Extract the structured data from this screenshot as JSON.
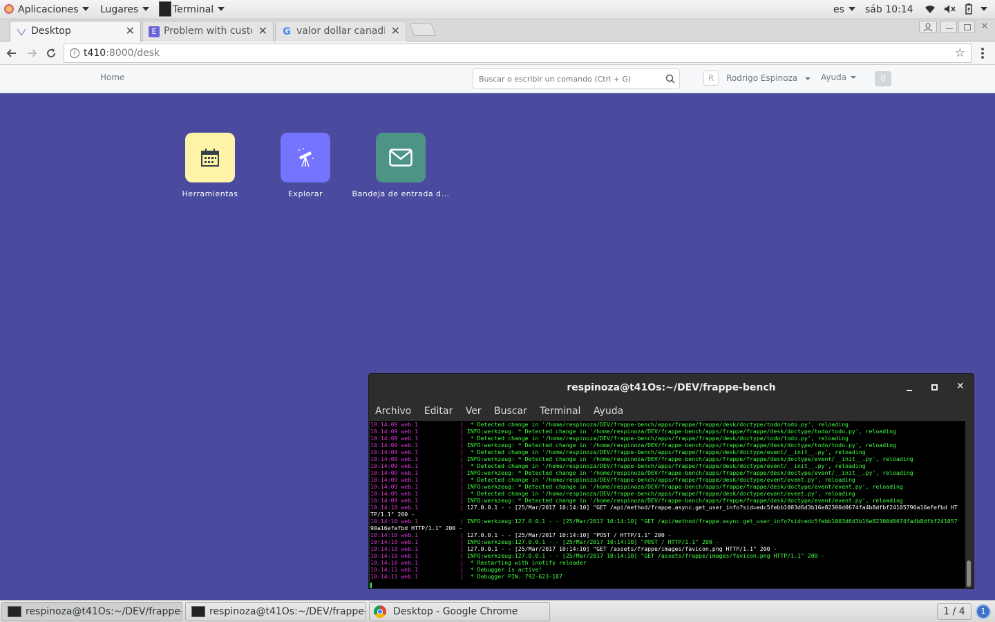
{
  "topbar": {
    "applications": "Aplicaciones",
    "places": "Lugares",
    "active_app": "Terminal",
    "language": "es",
    "clock": "sáb 10:14"
  },
  "browser": {
    "tabs": [
      {
        "label": "Desktop",
        "icon": "frappe-desk-icon"
      },
      {
        "label": "Problem with custo",
        "icon": "letter-e-icon"
      },
      {
        "label": "valor dollar canadie",
        "icon": "google-icon"
      }
    ],
    "url_host": "t410",
    "url_rest": ":8000/desk"
  },
  "navbar": {
    "home": "Home",
    "search_placeholder": "Buscar o escribir un comando (Ctrl + G)",
    "avatar_letter": "R",
    "user": "Rodrigo Espinoza",
    "help": "Ayuda",
    "notifications": "0"
  },
  "desk": {
    "icons": [
      {
        "label": "Herramientas",
        "icon": "calendar-icon",
        "color": "#fef3a6"
      },
      {
        "label": "Explorar",
        "icon": "telescope-icon",
        "color": "#7574ff"
      },
      {
        "label": "Bandeja de entrada d...",
        "icon": "envelope-icon",
        "color": "#4d9486"
      }
    ],
    "background": "#4a4a9f"
  },
  "terminal": {
    "title": "respinoza@t41Os:~/DEV/frappe-bench",
    "menu": [
      "Archivo",
      "Editar",
      "Ver",
      "Buscar",
      "Terminal",
      "Ayuda"
    ],
    "lines": [
      {
        "ts": "10:14:09 web.1",
        "msg": "  * Detected change in '/home/respinoza/DEV/frappe-bench/apps/frappe/frappe/desk/doctype/todo/todo.py', reloading"
      },
      {
        "ts": "10:14:09 web.1",
        "msg": " INFO:werkzeug: * Detected change in '/home/respinoza/DEV/frappe-bench/apps/frappe/frappe/desk/doctype/todo/todo.py', reloading"
      },
      {
        "ts": "10:14:09 web.1",
        "msg": "  * Detected change in '/home/respinoza/DEV/frappe-bench/apps/frappe/frappe/desk/doctype/todo/todo.py', reloading"
      },
      {
        "ts": "10:14:09 web.1",
        "msg": " INFO:werkzeug: * Detected change in '/home/respinoza/DEV/frappe-bench/apps/frappe/frappe/desk/doctype/todo/todo.py', reloading"
      },
      {
        "ts": "10:14:09 web.1",
        "msg": "  * Detected change in '/home/respinoza/DEV/frappe-bench/apps/frappe/frappe/desk/doctype/event/__init__.py', reloading"
      },
      {
        "ts": "10:14:09 web.1",
        "msg": " INFO:werkzeug: * Detected change in '/home/respinoza/DEV/frappe-bench/apps/frappe/frappe/desk/doctype/event/__init__.py', reloading"
      },
      {
        "ts": "10:14:09 web.1",
        "msg": "  * Detected change in '/home/respinoza/DEV/frappe-bench/apps/frappe/frappe/desk/doctype/event/__init__.py', reloading"
      },
      {
        "ts": "10:14:09 web.1",
        "msg": " INFO:werkzeug: * Detected change in '/home/respinoza/DEV/frappe-bench/apps/frappe/frappe/desk/doctype/event/__init__.py', reloading"
      },
      {
        "ts": "10:14:09 web.1",
        "msg": "  * Detected change in '/home/respinoza/DEV/frappe-bench/apps/frappe/frappe/desk/doctype/event/event.py', reloading"
      },
      {
        "ts": "10:14:09 web.1",
        "msg": " INFO:werkzeug: * Detected change in '/home/respinoza/DEV/frappe-bench/apps/frappe/frappe/desk/doctype/event/event.py', reloading"
      },
      {
        "ts": "10:14:09 web.1",
        "msg": "  * Detected change in '/home/respinoza/DEV/frappe-bench/apps/frappe/frappe/desk/doctype/event/event.py', reloading"
      },
      {
        "ts": "10:14:09 web.1",
        "msg": " INFO:werkzeug: * Detected change in '/home/respinoza/DEV/frappe-bench/apps/frappe/frappe/desk/doctype/event/event.py', reloading"
      },
      {
        "ts": "10:14:10 web.1",
        "msg": " 127.0.0.1 - - [25/Mar/2017 10:14:10] \"GET /api/method/frappe.async.get_user_info?sid=edc5febb1003d6d3b16e82300d0674fa4b8dfbf24105790a16efefbd HT"
      },
      {
        "ts": "",
        "msg": "TP/1.1\" 200 -"
      },
      {
        "ts": "10:14:10 web.1",
        "msg": " INFO:werkzeug:127.0.0.1 - - [25/Mar/2017 10:14:10] \"GET /api/method/frappe.async.get_user_info?sid=edc5febb1003d6d3b16e82300d0674fa4b8dfbf241057"
      },
      {
        "ts": "",
        "msg": "90a16efefbd HTTP/1.1\" 200 -"
      },
      {
        "ts": "10:14:10 web.1",
        "msg": " 127.0.0.1 - - [25/Mar/2017 10:14:10] \"POST / HTTP/1.1\" 200 -"
      },
      {
        "ts": "10:14:10 web.1",
        "msg": " INFO:werkzeug:127.0.0.1 - - [25/Mar/2017 10:14:10] \"POST / HTTP/1.1\" 200 -"
      },
      {
        "ts": "10:14:10 web.1",
        "msg": " 127.0.0.1 - - [25/Mar/2017 10:14:10] \"GET /assets/frappe/images/favicon.png HTTP/1.1\" 200 -"
      },
      {
        "ts": "10:14:10 web.1",
        "msg": " INFO:werkzeug:127.0.0.1 - - [25/Mar/2017 10:14:10] \"GET /assets/frappe/images/favicon.png HTTP/1.1\" 200 -"
      },
      {
        "ts": "10:14:10 web.1",
        "msg": "  * Restarting with inotify reloader"
      },
      {
        "ts": "10:14:11 web.1",
        "msg": "  * Debugger is active!"
      },
      {
        "ts": "10:14:11 web.1",
        "msg": "  * Debugger PIN: 792-623-187"
      }
    ]
  },
  "taskbar": {
    "tasks": [
      {
        "label": "respinoza@t41Os:~/DEV/frappe-...",
        "icon": "terminal-icon"
      },
      {
        "label": "respinoza@t41Os:~/DEV/frappe-...",
        "icon": "terminal-icon"
      },
      {
        "label": "Desktop - Google Chrome",
        "icon": "chrome-icon"
      }
    ],
    "workspace": "1 / 4",
    "notification_count": "1"
  }
}
